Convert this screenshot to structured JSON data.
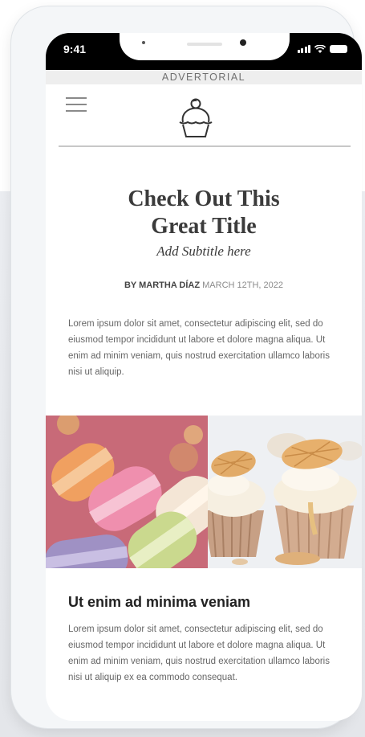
{
  "status_bar": {
    "time": "9:41",
    "icons": [
      "signal-icon",
      "wifi-icon",
      "battery-icon"
    ]
  },
  "advertorial_label": "ADVERTORIAL",
  "header": {
    "menu_icon": "hamburger-menu-icon",
    "logo_icon": "cupcake-logo-icon"
  },
  "article": {
    "title_line1": "Check Out This",
    "title_line2": "Great Title",
    "subtitle": "Add Subtitle here",
    "byline_author": "BY MARTHA DÍAZ",
    "byline_date": "MARCH 12TH, 2022",
    "intro": "Lorem ipsum dolor sit amet, consectetur adipiscing elit, sed do eiusmod tempor incididunt ut labore et dolore magna aliqua. Ut enim ad minim veniam, quis nostrud exercitation ullamco laboris nisi ut aliquip.",
    "images": [
      "macarons-photo",
      "cupcakes-photo"
    ],
    "section_heading": "Ut enim ad minima veniam",
    "body": "Lorem ipsum dolor sit amet, consectetur adipiscing elit, sed do eiusmod tempor incididunt ut labore et dolore magna aliqua. Ut enim ad minim veniam, quis nostrud exercitation ullamco laboris nisi ut aliquip ex ea commodo consequat."
  },
  "colors": {
    "status_bar": "#000000",
    "advertorial_bar": "#eeeeee",
    "title": "#3b3b3b",
    "body_text": "#666666",
    "macaron_background": "#c36674"
  }
}
